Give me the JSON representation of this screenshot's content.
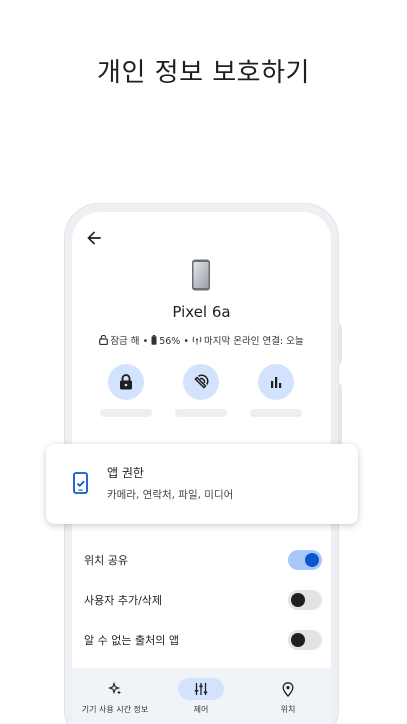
{
  "headline": "개인 정보 보호하기",
  "device": {
    "name": "Pixel 6a",
    "lock_status": "잠금 해",
    "battery": "56%",
    "last_online": "마지막 온라인 연결: 오늘"
  },
  "actions": [
    {
      "icon": "lock-icon"
    },
    {
      "icon": "ring-device-icon"
    },
    {
      "icon": "bar-chart-icon"
    }
  ],
  "permission_card": {
    "title": "앱 권한",
    "subtitle": "카메라, 연락처, 파일, 미디어"
  },
  "toggles": [
    {
      "label": "위치 공유",
      "on": true
    },
    {
      "label": "사용자 추가/삭제",
      "on": false
    },
    {
      "label": "알 수 없는 출처의 앱",
      "on": false
    }
  ],
  "nav": [
    {
      "label": "기기 사용 시간 정보",
      "icon": "sparkle-icon",
      "active": false
    },
    {
      "label": "제어",
      "icon": "sliders-icon",
      "active": true
    },
    {
      "label": "위치",
      "icon": "location-pin-icon",
      "active": false
    }
  ],
  "colors": {
    "accent": "#0b57d0",
    "accent_container": "#d3e3fd",
    "nav_background": "#f0f4f9"
  }
}
